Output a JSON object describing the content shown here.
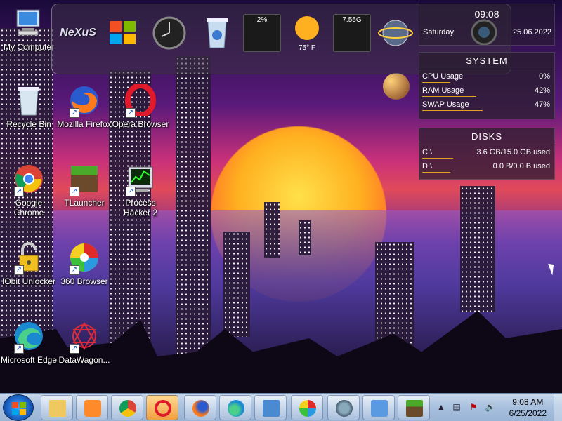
{
  "desktop_icons": [
    {
      "label": "My Computer"
    },
    {
      "label": "Recycle Bin"
    },
    {
      "label": "Mozilla Firefox"
    },
    {
      "label": "Opera Browser"
    },
    {
      "label": "Google Chrome"
    },
    {
      "label": "TLauncher"
    },
    {
      "label": "Process Hacker 2"
    },
    {
      "label": "IObit Unlocker"
    },
    {
      "label": "360 Browser"
    },
    {
      "label": "Microsoft Edge"
    },
    {
      "label": "DataWagon..."
    }
  ],
  "dock": {
    "cpu_gauge": "2%",
    "weather_temp": "75° F",
    "disk_gauge": "7.55G",
    "logo_text": "NeXuS"
  },
  "clock_widget": {
    "time": "09:08",
    "day": "Saturday",
    "date": "25.06.2022"
  },
  "system_widget": {
    "title": "SYSTEM",
    "rows": [
      {
        "label": "CPU Usage",
        "value": "0%",
        "level": 0
      },
      {
        "label": "RAM Usage",
        "value": "42%",
        "level": 42
      },
      {
        "label": "SWAP Usage",
        "value": "47%",
        "level": 47
      }
    ]
  },
  "disks_widget": {
    "title": "DISKS",
    "rows": [
      {
        "label": "C:\\",
        "value": "3.6 GB/15.0 GB used",
        "level": 24
      },
      {
        "label": "D:\\",
        "value": "0.0 B/0.0 B used",
        "level": 0
      }
    ]
  },
  "taskbar": {
    "time": "9:08 AM",
    "date": "6/25/2022"
  },
  "colors": {
    "accent_bar": "#e0a020",
    "taskbar": "#a8c0de"
  }
}
